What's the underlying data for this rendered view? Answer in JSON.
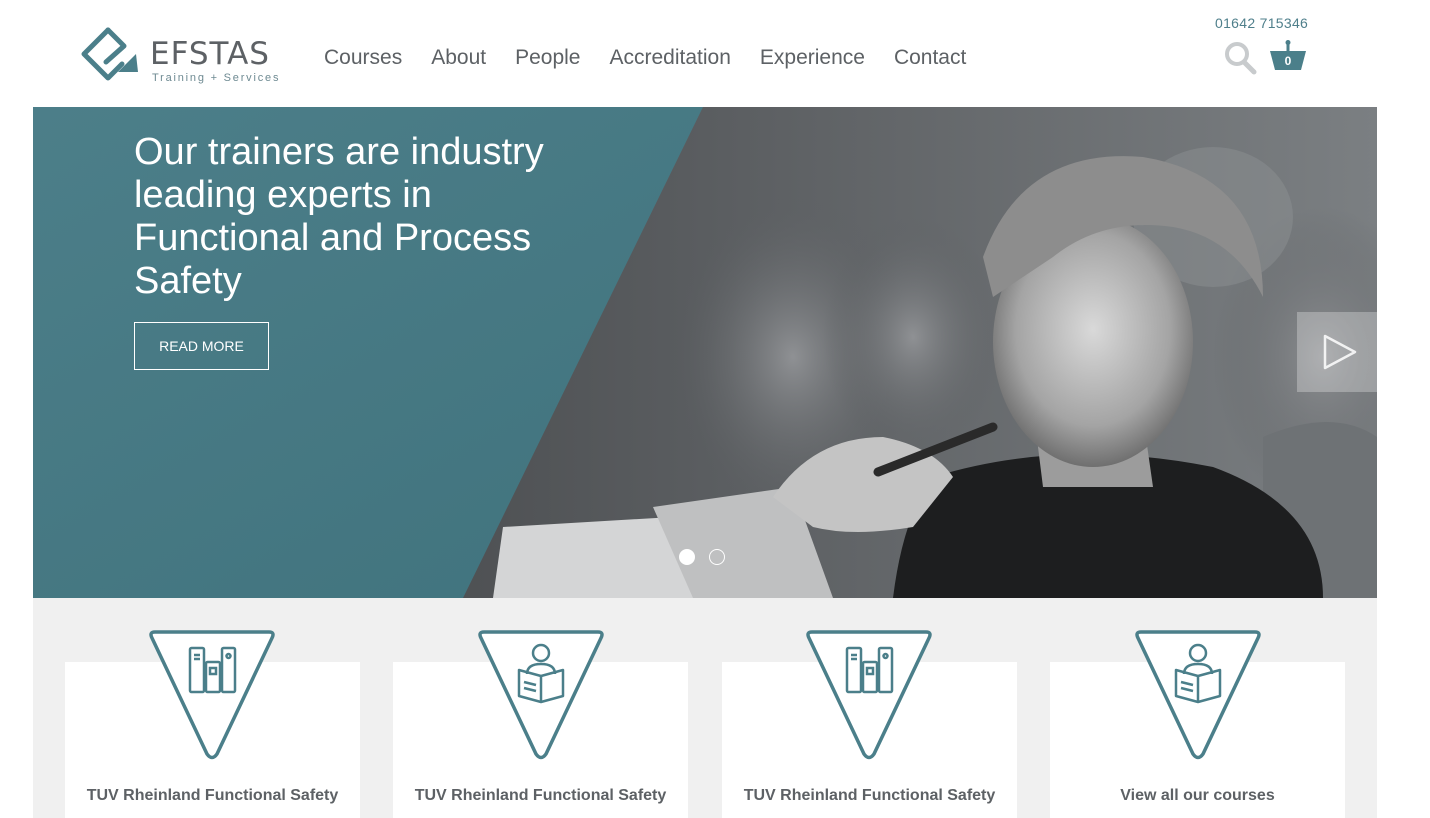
{
  "header": {
    "logo": {
      "name": "EFSTAS",
      "tagline": "Training + Services"
    },
    "nav": [
      "Courses",
      "About",
      "People",
      "Accreditation",
      "Experience",
      "Contact"
    ],
    "phone": "01642 715346",
    "cart_count": "0",
    "icons": {
      "search": "search-icon",
      "cart": "basket-icon"
    }
  },
  "hero": {
    "title": "Our trainers are industry leading experts in Functional and Process Safety",
    "button_label": "READ MORE",
    "slides_total": 2,
    "active_slide": 1,
    "icons": {
      "next": "play-arrow-icon"
    }
  },
  "cards": [
    {
      "label": "TUV Rheinland Functional Safety",
      "icon": "books-icon"
    },
    {
      "label": "TUV Rheinland Functional Safety",
      "icon": "reader-icon"
    },
    {
      "label": "TUV Rheinland Functional Safety",
      "icon": "books-icon"
    },
    {
      "label": "View all our courses",
      "icon": "reader-icon"
    }
  ],
  "colors": {
    "accent": "#4b7f8a",
    "text": "#5d6165",
    "band": "#f0f0f0"
  }
}
